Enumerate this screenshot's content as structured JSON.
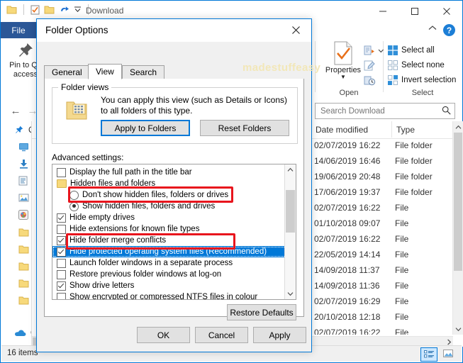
{
  "explorer": {
    "title": "Download",
    "quick_access_icons": [
      "folder-icon",
      "properties-icon",
      "new-folder-icon",
      "undo-icon",
      "customize-caret-icon"
    ],
    "window_controls": {
      "minimize": "minimize-icon",
      "maximize": "maximize-icon",
      "close": "close-icon"
    },
    "tabs": {
      "file": "File"
    },
    "ribbon": {
      "collapse_label": "collapse-ribbon-icon",
      "help_label": "?",
      "pin_button": {
        "label_line1": "Pin to Qu",
        "label_line2": "access"
      },
      "properties_button": {
        "label": "Properties"
      },
      "groups": {
        "open": "Open",
        "select": "Select"
      },
      "select_items": [
        {
          "label": "Select all",
          "icon": "select-all-icon"
        },
        {
          "label": "Select none",
          "icon": "select-none-icon"
        },
        {
          "label": "Invert selection",
          "icon": "invert-selection-icon"
        }
      ]
    },
    "search": {
      "placeholder": "Search Download",
      "value": "",
      "icon": "search-icon"
    },
    "nav_buttons": {
      "back": "back-arrow-icon",
      "forward": "forward-arrow-icon"
    },
    "nav_pane": [
      {
        "icon": "pin-icon",
        "label": "Q"
      },
      {
        "icon": "desktop-icon",
        "label": ""
      },
      {
        "icon": "downloads-icon",
        "label": ""
      },
      {
        "icon": "documents-icon",
        "label": ""
      },
      {
        "icon": "pictures-icon",
        "label": ""
      },
      {
        "icon": "music-icon",
        "label": ""
      },
      {
        "icon": "folder-icon",
        "label": ""
      },
      {
        "icon": "folder-icon",
        "label": ""
      },
      {
        "icon": "folder-icon",
        "label": ""
      },
      {
        "icon": "folder-icon",
        "label": ""
      },
      {
        "icon": "folder-icon",
        "label": ""
      },
      {
        "icon": "onedrive-icon",
        "label": "O"
      }
    ],
    "columns": [
      {
        "label": "Date modified"
      },
      {
        "label": "Type"
      }
    ],
    "rows": [
      {
        "date": "02/07/2019 16:22",
        "type": "File folder"
      },
      {
        "date": "14/06/2019 16:46",
        "type": "File folder"
      },
      {
        "date": "19/06/2019 20:48",
        "type": "File folder"
      },
      {
        "date": "17/06/2019 19:37",
        "type": "File folder"
      },
      {
        "date": "02/07/2019 16:22",
        "type": "File"
      },
      {
        "date": "01/10/2018 09:07",
        "type": "File"
      },
      {
        "date": "02/07/2019 16:22",
        "type": "File"
      },
      {
        "date": "22/05/2019 14:14",
        "type": "File"
      },
      {
        "date": "14/09/2018 11:37",
        "type": "File"
      },
      {
        "date": "14/09/2018 11:36",
        "type": "File"
      },
      {
        "date": "02/07/2019 16:29",
        "type": "File"
      },
      {
        "date": "20/10/2018 12:18",
        "type": "File"
      },
      {
        "date": "02/07/2019 16:22",
        "type": "File"
      }
    ],
    "status": {
      "items_text": "16 items",
      "view_details": "details-view-icon",
      "view_large": "large-icons-view-icon"
    }
  },
  "dialog": {
    "title": "Folder Options",
    "close_icon": "close-icon",
    "watermark": "madestuffeasy",
    "tabs": [
      {
        "label": "General",
        "active": false
      },
      {
        "label": "View",
        "active": true
      },
      {
        "label": "Search",
        "active": false
      }
    ],
    "folder_views": {
      "legend": "Folder views",
      "description": "You can apply this view (such as Details or Icons) to all folders of this type.",
      "icon": "folder-views-icon",
      "apply_button": "Apply to Folders",
      "reset_button": "Reset Folders"
    },
    "advanced_label": "Advanced settings:",
    "advanced_items": [
      {
        "label": "Display the full path in the title bar",
        "control": "checkbox",
        "checked": false,
        "level": 0,
        "selected": false
      },
      {
        "label": "Hidden files and folders",
        "control": "folder",
        "checked": false,
        "level": 0,
        "selected": false
      },
      {
        "label": "Don't show hidden files, folders or drives",
        "control": "radio",
        "checked": false,
        "level": 1,
        "selected": false
      },
      {
        "label": "Show hidden files, folders and drives",
        "control": "radio",
        "checked": true,
        "level": 1,
        "selected": false
      },
      {
        "label": "Hide empty drives",
        "control": "checkbox",
        "checked": true,
        "level": 0,
        "selected": false
      },
      {
        "label": "Hide extensions for known file types",
        "control": "checkbox",
        "checked": false,
        "level": 0,
        "selected": false
      },
      {
        "label": "Hide folder merge conflicts",
        "control": "checkbox",
        "checked": true,
        "level": 0,
        "selected": false
      },
      {
        "label": "Hide protected operating system files (Recommended)",
        "control": "checkbox",
        "checked": true,
        "level": 0,
        "selected": true
      },
      {
        "label": "Launch folder windows in a separate process",
        "control": "checkbox",
        "checked": false,
        "level": 0,
        "selected": false
      },
      {
        "label": "Restore previous folder windows at log-on",
        "control": "checkbox",
        "checked": false,
        "level": 0,
        "selected": false
      },
      {
        "label": "Show drive letters",
        "control": "checkbox",
        "checked": true,
        "level": 0,
        "selected": false
      },
      {
        "label": "Show encrypted or compressed NTFS files in colour",
        "control": "checkbox",
        "checked": false,
        "level": 0,
        "selected": false
      }
    ],
    "restore_defaults": "Restore Defaults",
    "buttons": {
      "ok": "OK",
      "cancel": "Cancel",
      "apply": "Apply"
    }
  },
  "annotations": {
    "highlight_color": "#e8151d",
    "boxes": [
      {
        "target": "show-hidden-files-radio-row"
      },
      {
        "target": "hide-protected-os-files-row"
      }
    ]
  }
}
